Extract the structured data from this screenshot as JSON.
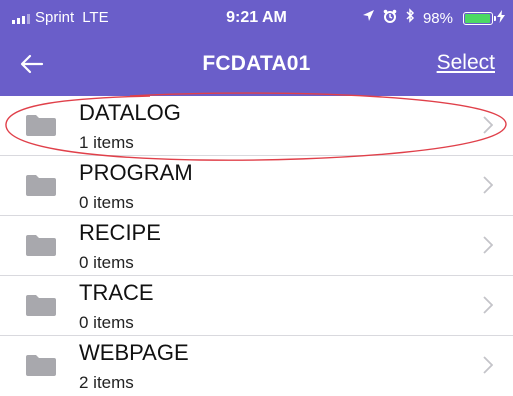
{
  "status_bar": {
    "carrier": "Sprint",
    "network": "LTE",
    "time": "9:21 AM",
    "battery": "98%",
    "battery_level": 0.98,
    "icons": [
      "signal-icon",
      "location-arrow-icon",
      "alarm-icon",
      "bluetooth-icon",
      "battery-icon",
      "charging-bolt-icon"
    ]
  },
  "nav": {
    "title": "FCDATA01",
    "back_icon": "back-arrow-icon",
    "select_label": "Select"
  },
  "folders": [
    {
      "name": "DATALOG",
      "count": "1 items"
    },
    {
      "name": "PROGRAM",
      "count": "0 items"
    },
    {
      "name": "RECIPE",
      "count": "0 items"
    },
    {
      "name": "TRACE",
      "count": "0 items"
    },
    {
      "name": "WEBPAGE",
      "count": "2 items"
    }
  ],
  "colors": {
    "nav_background": "#6a5ec9",
    "battery_fill": "#4cd964",
    "folder_icon": "#a8a8ad",
    "chevron": "#c4c4c9",
    "annotation": "#e0404a"
  }
}
